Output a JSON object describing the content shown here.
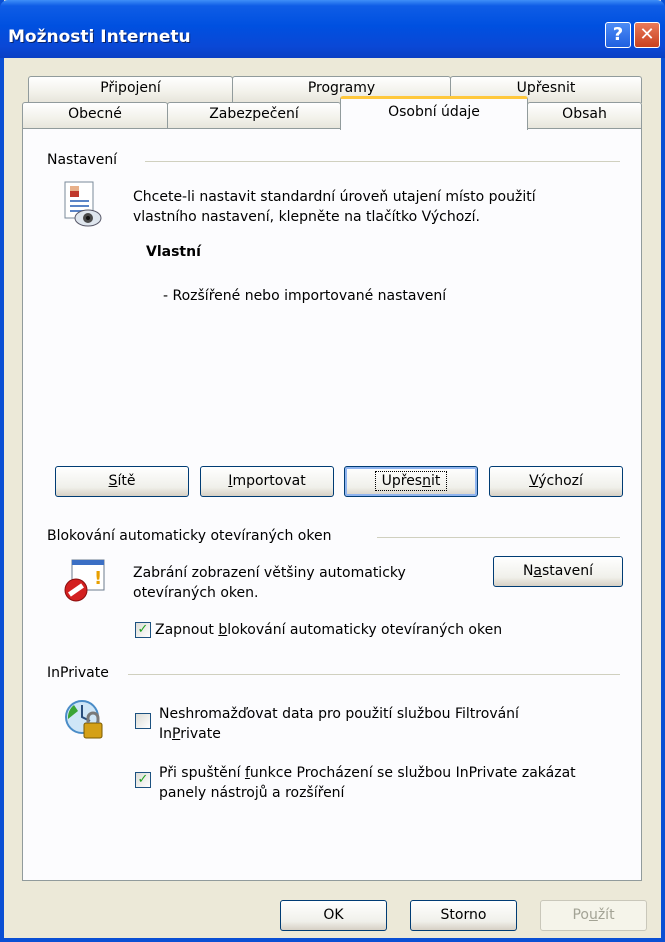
{
  "window": {
    "title": "Možnosti Internetu",
    "help_glyph": "?",
    "close_glyph": "✕"
  },
  "tabs": [
    {
      "label": "Připojení"
    },
    {
      "label": "Programy"
    },
    {
      "label": "Upřesnit"
    },
    {
      "label": "Obecné"
    },
    {
      "label": "Zabezpečení"
    },
    {
      "label": "Osobní údaje",
      "active": true
    },
    {
      "label": "Obsah"
    }
  ],
  "settings": {
    "heading": "Nastavení",
    "description_line1": "Chcete-li nastavit standardní úroveň utajení místo použití",
    "description_line2": "vlastního nastavení, klepněte na tlačítko Výchozí.",
    "level": "Vlastní",
    "level_detail": "- Rozšířené nebo importované nastavení",
    "buttons": {
      "sites": [
        "",
        "S",
        "ítě"
      ],
      "import": [
        "",
        "I",
        "mportovat"
      ],
      "advanced": [
        "Upřes",
        "n",
        "it"
      ],
      "default": [
        "",
        "V",
        "ýchozí"
      ]
    }
  },
  "popup": {
    "heading": "Blokování automaticky otevíraných oken",
    "description_line1": "Zabrání zobrazení většiny automaticky",
    "description_line2": "otevíraných oken.",
    "settings_button": [
      "N",
      "a",
      "stavení"
    ],
    "enable_label": [
      "Zapnout ",
      "b",
      "lokování automaticky otevíraných oken"
    ],
    "enable_checked": true
  },
  "inprivate": {
    "heading": "InPrivate",
    "filter_label_line1": "Neshromažďovat data pro použití službou Filtrování",
    "filter_label_line2": [
      "In",
      "P",
      "rivate"
    ],
    "filter_checked": false,
    "toolbar_label_line1": [
      "Při spuštění ",
      "f",
      "unkce Procházení se službou InPrivate zakázat"
    ],
    "toolbar_label_line2": "panely nástrojů a rozšíření",
    "toolbar_checked": true
  },
  "footer": {
    "ok": "OK",
    "cancel": "Storno",
    "apply": [
      "Po",
      "u",
      "žít"
    ]
  },
  "colors": {
    "titlebar": "#0054e3",
    "dialog_bg": "#ece9d8",
    "panel_bg": "#fcfcfe",
    "active_tab_accent": "#ffc83c",
    "check_mark": "#21a121"
  }
}
